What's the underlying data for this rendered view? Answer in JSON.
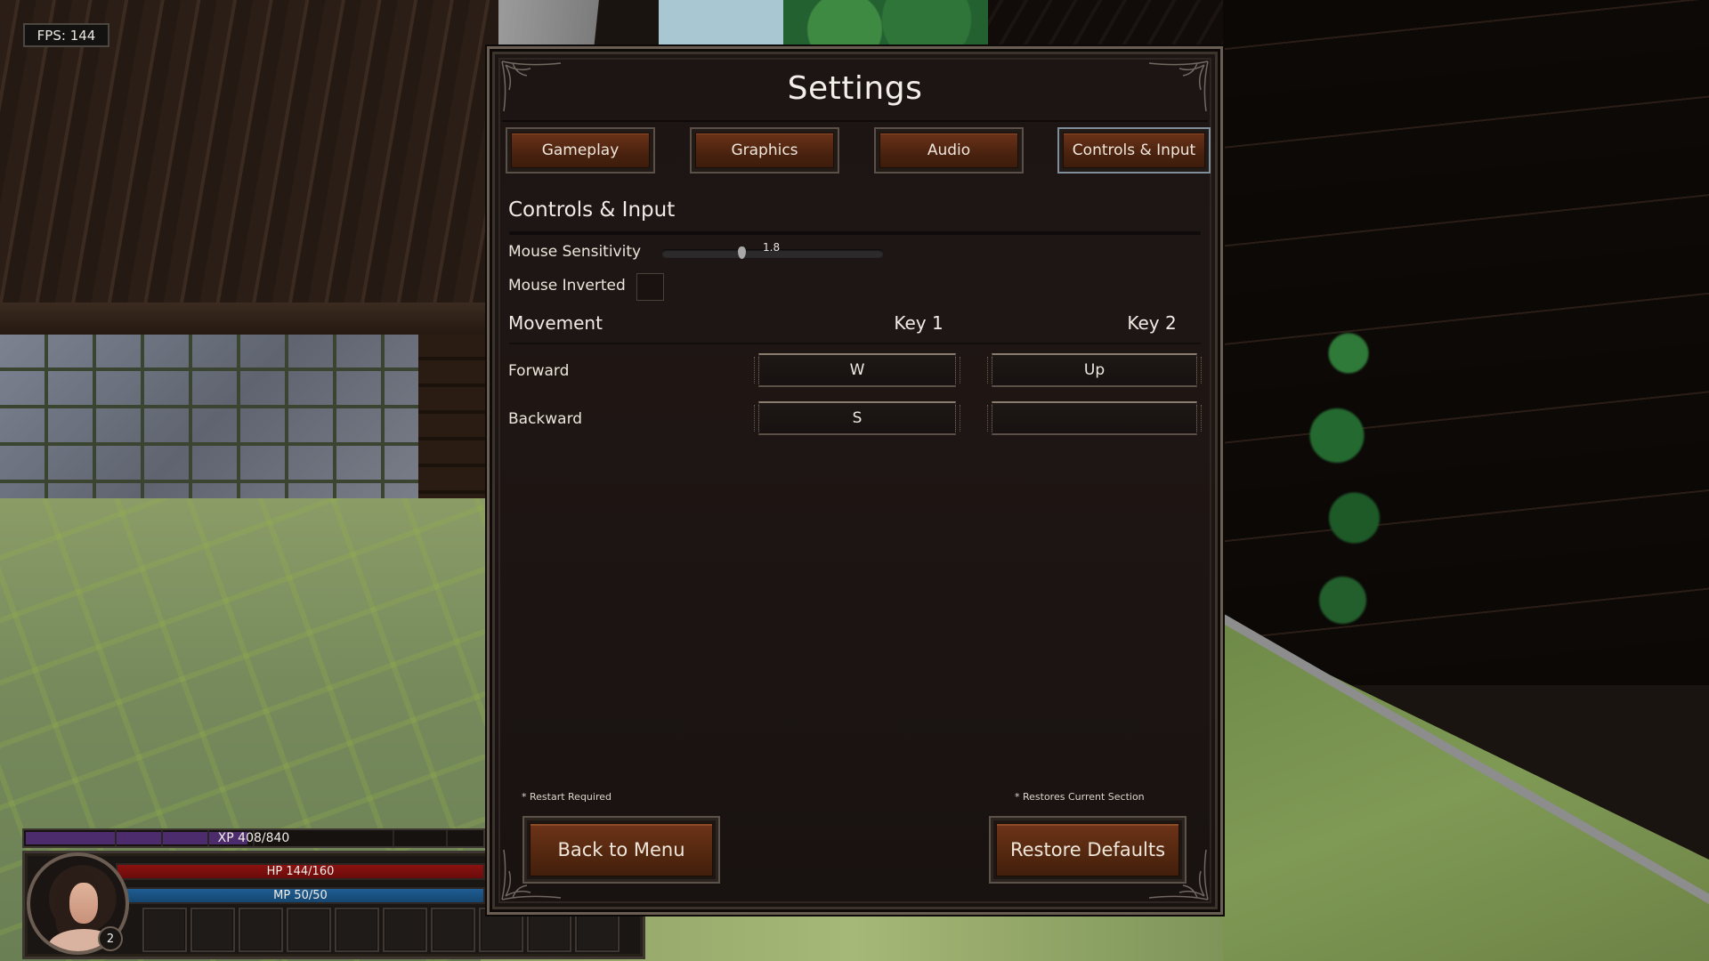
{
  "hud": {
    "fps_label": "FPS: 144",
    "xp": {
      "text": "XP 408/840",
      "current": 408,
      "max": 840
    },
    "hp": {
      "text": "HP 144/160",
      "current": 144,
      "max": 160
    },
    "mp": {
      "text": "MP 50/50",
      "current": 50,
      "max": 50
    },
    "level": "2",
    "hotbar_slots": 10
  },
  "settings": {
    "title": "Settings",
    "tabs": [
      {
        "label": "Gameplay",
        "active": false
      },
      {
        "label": "Graphics",
        "active": false
      },
      {
        "label": "Audio",
        "active": false
      },
      {
        "label": "Controls & Input",
        "active": true
      }
    ],
    "section_title": "Controls & Input",
    "mouse_sensitivity": {
      "label": "Mouse Sensitivity",
      "value": 1.8,
      "value_text": "1.8",
      "fraction": 0.36
    },
    "mouse_inverted": {
      "label": "Mouse Inverted",
      "checked": false
    },
    "bindings": {
      "group": "Movement",
      "col_key1": "Key 1",
      "col_key2": "Key 2",
      "rows": [
        {
          "action": "Forward",
          "key1": "W",
          "key2": "Up"
        },
        {
          "action": "Backward",
          "key1": "S",
          "key2": ""
        }
      ]
    },
    "footnote_left": "* Restart Required",
    "footnote_right": "* Restores Current Section",
    "back_button": "Back to Menu",
    "restore_button": "Restore Defaults"
  },
  "colors": {
    "accent_button": "#5a2a12",
    "active_tab_border": "#7f8e99",
    "hp": "#8a1210",
    "mp": "#1f5d92",
    "xp": "#4d2c6e"
  }
}
